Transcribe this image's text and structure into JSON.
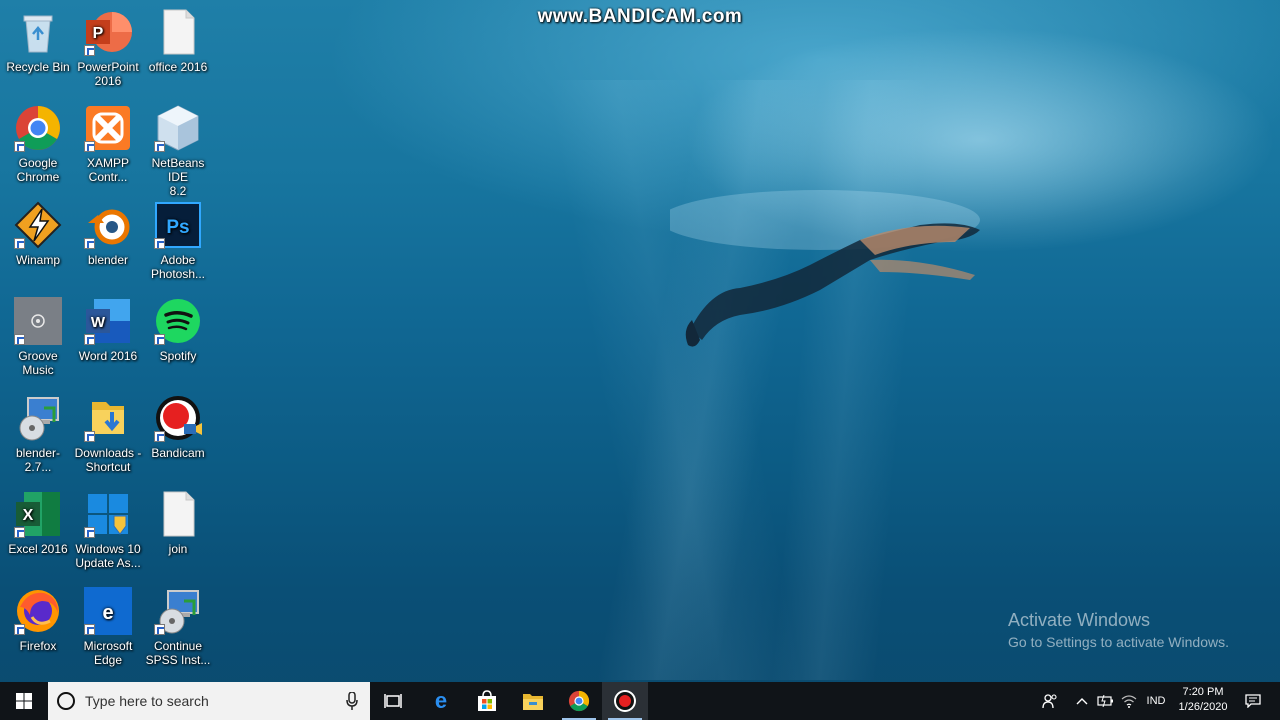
{
  "watermark": "www.BANDICAM.com",
  "activation": {
    "title": "Activate Windows",
    "subtitle": "Go to Settings to activate Windows."
  },
  "desktop_icons": [
    {
      "label_lines": [
        "Recycle Bin"
      ],
      "icon": "recycle-bin-icon"
    },
    {
      "label_lines": [
        "PowerPoint",
        "2016"
      ],
      "icon": "powerpoint-icon"
    },
    {
      "label_lines": [
        "office 2016"
      ],
      "icon": "document-icon"
    },
    {
      "label_lines": [
        "Google",
        "Chrome"
      ],
      "icon": "chrome-icon"
    },
    {
      "label_lines": [
        "XAMPP",
        "Contr..."
      ],
      "icon": "xampp-icon"
    },
    {
      "label_lines": [
        "NetBeans IDE",
        "8.2"
      ],
      "icon": "netbeans-icon"
    },
    {
      "label_lines": [
        "Winamp"
      ],
      "icon": "winamp-icon"
    },
    {
      "label_lines": [
        "blender"
      ],
      "icon": "blender-icon"
    },
    {
      "label_lines": [
        "Adobe",
        "Photosh..."
      ],
      "icon": "photoshop-icon"
    },
    {
      "label_lines": [
        "Groove",
        "Music"
      ],
      "icon": "groove-music-icon"
    },
    {
      "label_lines": [
        "Word 2016"
      ],
      "icon": "word-icon"
    },
    {
      "label_lines": [
        "Spotify"
      ],
      "icon": "spotify-icon"
    },
    {
      "label_lines": [
        "blender-2.7..."
      ],
      "icon": "installer-icon"
    },
    {
      "label_lines": [
        "Downloads -",
        "Shortcut"
      ],
      "icon": "downloads-folder-icon"
    },
    {
      "label_lines": [
        "Bandicam"
      ],
      "icon": "bandicam-icon"
    },
    {
      "label_lines": [
        "Excel 2016"
      ],
      "icon": "excel-icon"
    },
    {
      "label_lines": [
        "Windows 10",
        "Update As..."
      ],
      "icon": "windows-update-icon"
    },
    {
      "label_lines": [
        "join"
      ],
      "icon": "document-icon"
    },
    {
      "label_lines": [
        "Firefox"
      ],
      "icon": "firefox-icon"
    },
    {
      "label_lines": [
        "Microsoft",
        "Edge"
      ],
      "icon": "edge-icon"
    },
    {
      "label_lines": [
        "Continue",
        "SPSS Inst..."
      ],
      "icon": "installer-icon"
    }
  ],
  "taskbar": {
    "search_placeholder": "Type here to search",
    "pinned": [
      "task-view-icon",
      "edge-icon",
      "store-icon",
      "file-explorer-icon",
      "chrome-icon",
      "bandicam-icon"
    ],
    "language": "IND",
    "time": "7:20 PM",
    "date": "1/26/2020"
  }
}
